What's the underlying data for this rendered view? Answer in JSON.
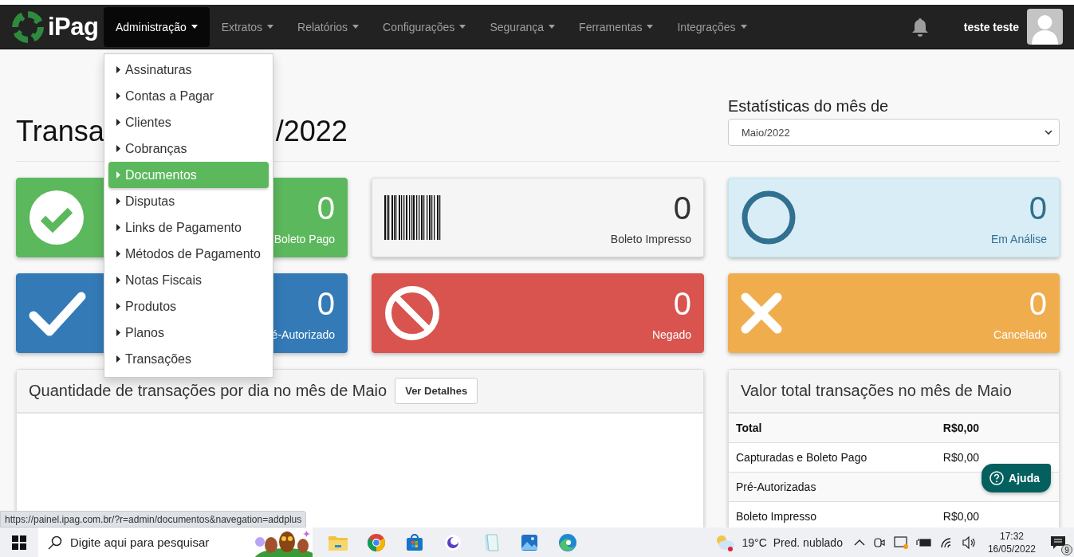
{
  "navbar": {
    "brand": "iPag",
    "menus": [
      {
        "label": "Administração",
        "selected": true
      },
      {
        "label": "Extratos",
        "selected": false
      },
      {
        "label": "Relatórios",
        "selected": false
      },
      {
        "label": "Configurações",
        "selected": false
      },
      {
        "label": "Segurança",
        "selected": false
      },
      {
        "label": "Ferramentas",
        "selected": false
      },
      {
        "label": "Integrações",
        "selected": false
      }
    ],
    "user_name": "teste teste"
  },
  "dropdown": {
    "items": [
      {
        "label": "Assinaturas",
        "selected": false
      },
      {
        "label": "Contas a Pagar",
        "selected": false
      },
      {
        "label": "Clientes",
        "selected": false
      },
      {
        "label": "Cobranças",
        "selected": false
      },
      {
        "label": "Documentos",
        "selected": true
      },
      {
        "label": "Disputas",
        "selected": false
      },
      {
        "label": "Links de Pagamento",
        "selected": false
      },
      {
        "label": "Métodos de Pagamento",
        "selected": false
      },
      {
        "label": "Notas Fiscais",
        "selected": false
      },
      {
        "label": "Produtos",
        "selected": false
      },
      {
        "label": "Planos",
        "selected": false
      },
      {
        "label": "Transações",
        "selected": false
      }
    ]
  },
  "page": {
    "title_parts": [
      "Transa",
      "/2022"
    ],
    "stats_label": "Estatísticas do mês de",
    "month_select": {
      "value": "Maio/2022"
    }
  },
  "cards": [
    {
      "kind": "success",
      "value": "0",
      "label": "Boleto Pago"
    },
    {
      "kind": "printed",
      "value": "0",
      "label": "Boleto Impresso"
    },
    {
      "kind": "info",
      "value": "0",
      "label": "Em Análise"
    },
    {
      "kind": "primary",
      "value": "0",
      "label": "é-Autorizado"
    },
    {
      "kind": "danger",
      "value": "0",
      "label": "Negado"
    },
    {
      "kind": "warning",
      "value": "0",
      "label": "Cancelado"
    }
  ],
  "chart_panel": {
    "title": "Quantidade de transações por dia no mês de Maio",
    "button": "Ver Detalhes"
  },
  "totals_panel": {
    "title": "Valor total transações no mês de Maio",
    "rows": [
      {
        "kind": "total",
        "label": "Total",
        "value": "R$0,00"
      },
      {
        "kind": "row",
        "label": "Capturadas e Boleto Pago",
        "value": "R$0,00"
      },
      {
        "kind": "row",
        "label": "Pré-Autorizadas"
      },
      {
        "kind": "row",
        "label": "Boleto Impresso",
        "value": "R$0,00"
      }
    ]
  },
  "help_button": "Ajuda",
  "status_url": "https://painel.ipag.com.br/?r=admin/documentos&navegation=addplus",
  "taskbar": {
    "search_placeholder": "Digite aqui para pesquisar",
    "temperature": "19°C",
    "weather": "Pred. nublado",
    "time": "17:32",
    "date": "16/05/2022",
    "notifications": "9"
  }
}
